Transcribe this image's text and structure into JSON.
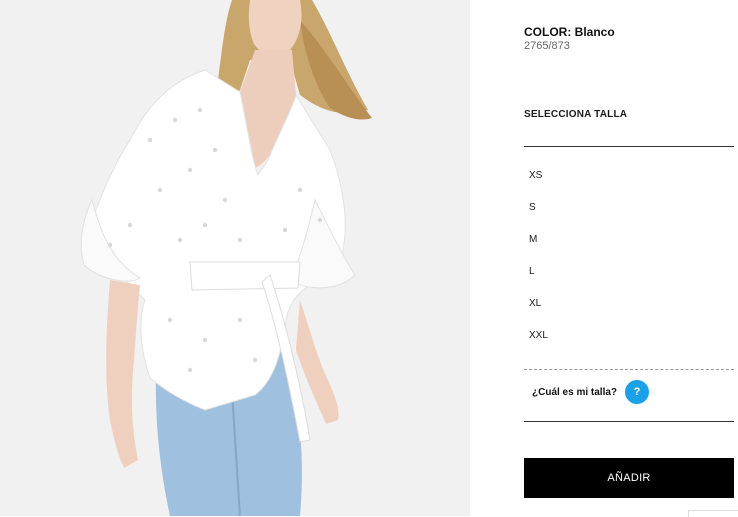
{
  "product": {
    "color_label": "COLOR:",
    "color_value": "Blanco",
    "reference": "2765/873",
    "image_alt": "product-photo"
  },
  "sizes": {
    "title": "SELECCIONA TALLA",
    "options": [
      "XS",
      "S",
      "M",
      "L",
      "XL",
      "XXL"
    ]
  },
  "size_help": {
    "label": "¿Cuál es mi talla?",
    "icon": "?"
  },
  "add_button": {
    "label": "AÑADIR"
  },
  "colors": {
    "accent_help": "#1aa1e8",
    "button_bg": "#000000",
    "button_text": "#ffffff"
  }
}
